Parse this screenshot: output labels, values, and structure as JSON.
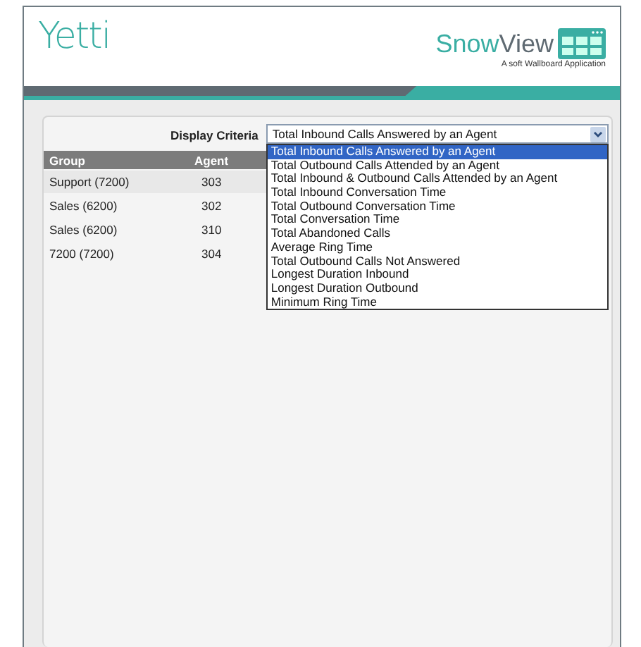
{
  "header": {
    "logo": "Yetti",
    "product": {
      "name_light": "Snow",
      "name_bold": "View",
      "tagline": "A soft Wallboard Application"
    }
  },
  "display_criteria": {
    "label": "Display Criteria",
    "value": "Total Inbound Calls Answered by an Agent",
    "expanded": true,
    "options": [
      {
        "label": "Total Inbound Calls Answered by an Agent",
        "selected": true
      },
      {
        "label": "Total Outbound Calls Attended by an Agent",
        "selected": false
      },
      {
        "label": "Total Inbound & Outbound Calls Attended by an Agent",
        "selected": false
      },
      {
        "label": "Total Inbound Conversation Time",
        "selected": false
      },
      {
        "label": "Total Outbound Conversation Time",
        "selected": false
      },
      {
        "label": "Total Conversation Time",
        "selected": false
      },
      {
        "label": "Total Abandoned Calls",
        "selected": false
      },
      {
        "label": "Average Ring Time",
        "selected": false
      },
      {
        "label": "Total Outbound Calls Not Answered",
        "selected": false
      },
      {
        "label": "Longest Duration Inbound",
        "selected": false
      },
      {
        "label": "Longest Duration Outbound",
        "selected": false
      },
      {
        "label": "Minimum Ring Time",
        "selected": false
      }
    ]
  },
  "table": {
    "columns": [
      "Group",
      "Agent"
    ],
    "rows": [
      {
        "cells": [
          "Support (7200)",
          "303"
        ],
        "selected": true
      },
      {
        "cells": [
          "Sales (6200)",
          "302"
        ],
        "selected": false
      },
      {
        "cells": [
          "Sales (6200)",
          "310"
        ],
        "selected": false
      },
      {
        "cells": [
          "7200 (7200)",
          "304"
        ],
        "selected": false
      }
    ]
  }
}
